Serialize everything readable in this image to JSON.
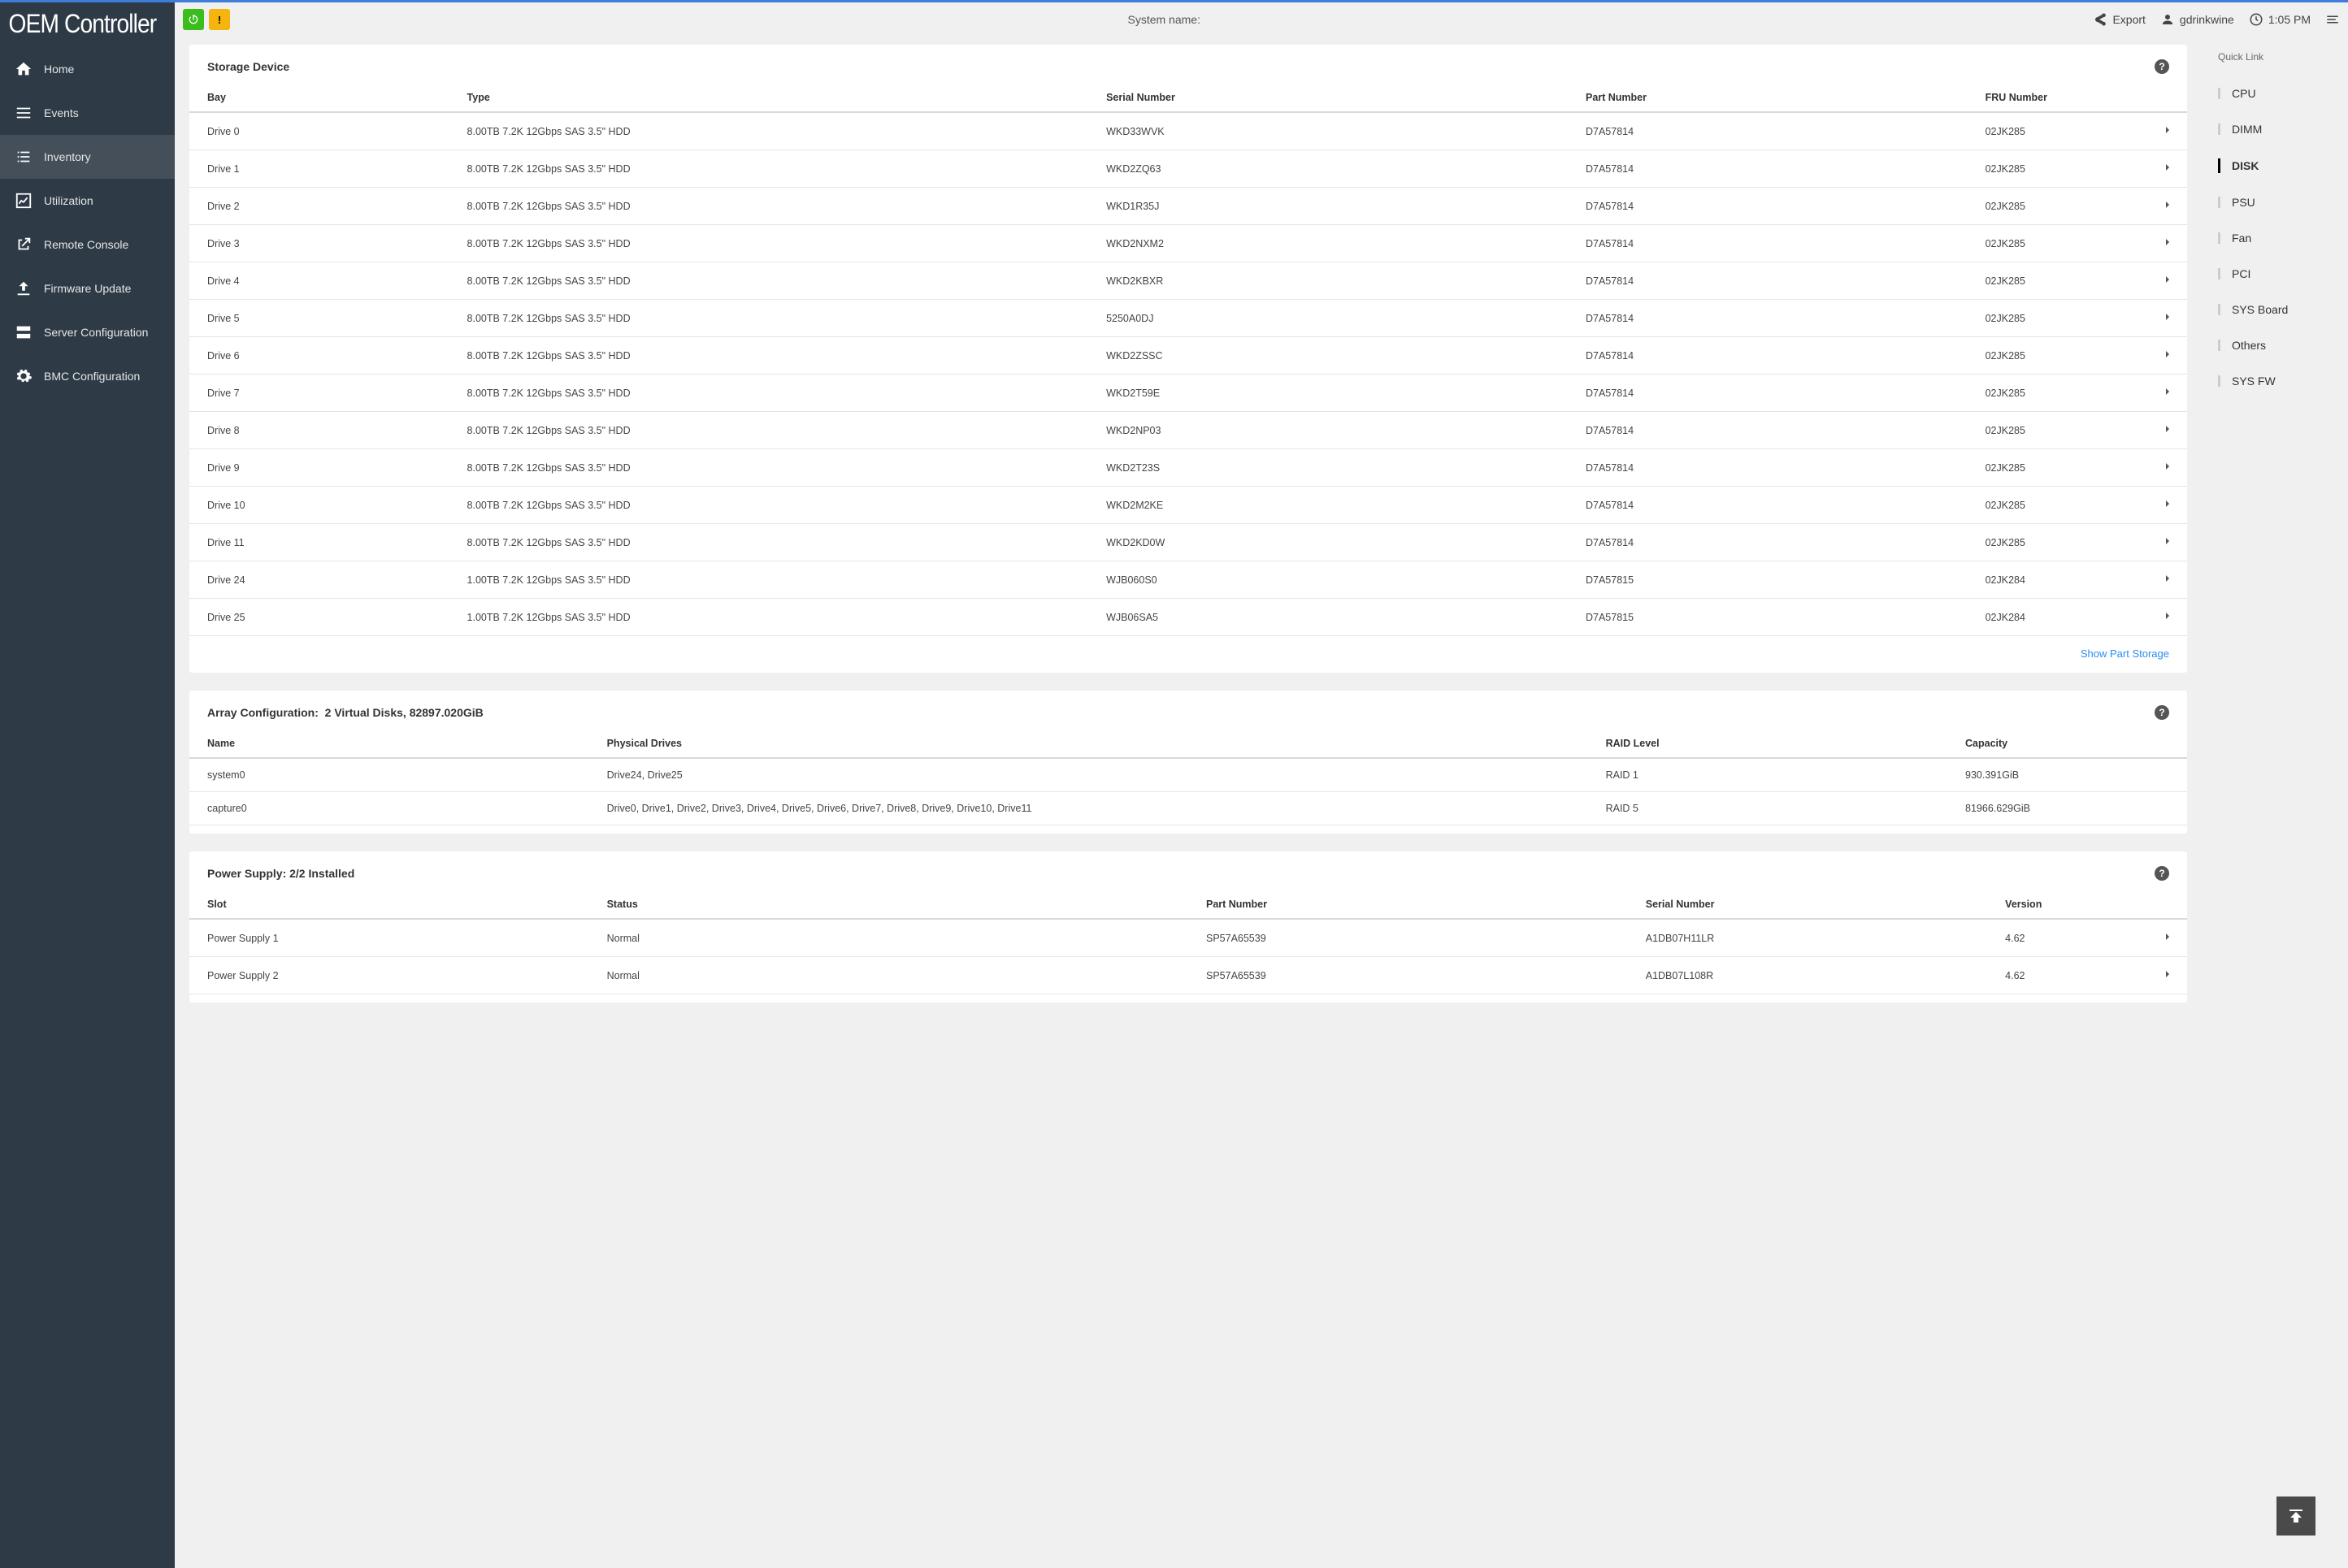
{
  "logo": "OEM Controller",
  "nav": [
    {
      "label": "Home"
    },
    {
      "label": "Events"
    },
    {
      "label": "Inventory"
    },
    {
      "label": "Utilization"
    },
    {
      "label": "Remote Console"
    },
    {
      "label": "Firmware Update"
    },
    {
      "label": "Server Configuration"
    },
    {
      "label": "BMC Configuration"
    }
  ],
  "topbar": {
    "system_name_label": "System name:",
    "export": "Export",
    "user": "gdrinkwine",
    "time": "1:05 PM"
  },
  "storage": {
    "title": "Storage Device",
    "headers": {
      "bay": "Bay",
      "type": "Type",
      "serial": "Serial Number",
      "part": "Part Number",
      "fru": "FRU Number"
    },
    "rows": [
      {
        "bay": "Drive 0",
        "type": "8.00TB 7.2K 12Gbps SAS 3.5\" HDD",
        "serial": "WKD33WVK",
        "part": "D7A57814",
        "fru": "02JK285"
      },
      {
        "bay": "Drive 1",
        "type": "8.00TB 7.2K 12Gbps SAS 3.5\" HDD",
        "serial": "WKD2ZQ63",
        "part": "D7A57814",
        "fru": "02JK285"
      },
      {
        "bay": "Drive 2",
        "type": "8.00TB 7.2K 12Gbps SAS 3.5\" HDD",
        "serial": "WKD1R35J",
        "part": "D7A57814",
        "fru": "02JK285"
      },
      {
        "bay": "Drive 3",
        "type": "8.00TB 7.2K 12Gbps SAS 3.5\" HDD",
        "serial": "WKD2NXM2",
        "part": "D7A57814",
        "fru": "02JK285"
      },
      {
        "bay": "Drive 4",
        "type": "8.00TB 7.2K 12Gbps SAS 3.5\" HDD",
        "serial": "WKD2KBXR",
        "part": "D7A57814",
        "fru": "02JK285"
      },
      {
        "bay": "Drive 5",
        "type": "8.00TB 7.2K 12Gbps SAS 3.5\" HDD",
        "serial": "5250A0DJ",
        "part": "D7A57814",
        "fru": "02JK285"
      },
      {
        "bay": "Drive 6",
        "type": "8.00TB 7.2K 12Gbps SAS 3.5\" HDD",
        "serial": "WKD2ZSSC",
        "part": "D7A57814",
        "fru": "02JK285"
      },
      {
        "bay": "Drive 7",
        "type": "8.00TB 7.2K 12Gbps SAS 3.5\" HDD",
        "serial": "WKD2T59E",
        "part": "D7A57814",
        "fru": "02JK285"
      },
      {
        "bay": "Drive 8",
        "type": "8.00TB 7.2K 12Gbps SAS 3.5\" HDD",
        "serial": "WKD2NP03",
        "part": "D7A57814",
        "fru": "02JK285"
      },
      {
        "bay": "Drive 9",
        "type": "8.00TB 7.2K 12Gbps SAS 3.5\" HDD",
        "serial": "WKD2T23S",
        "part": "D7A57814",
        "fru": "02JK285"
      },
      {
        "bay": "Drive 10",
        "type": "8.00TB 7.2K 12Gbps SAS 3.5\" HDD",
        "serial": "WKD2M2KE",
        "part": "D7A57814",
        "fru": "02JK285"
      },
      {
        "bay": "Drive 11",
        "type": "8.00TB 7.2K 12Gbps SAS 3.5\" HDD",
        "serial": "WKD2KD0W",
        "part": "D7A57814",
        "fru": "02JK285"
      },
      {
        "bay": "Drive 24",
        "type": "1.00TB 7.2K 12Gbps SAS 3.5\" HDD",
        "serial": "WJB060S0",
        "part": "D7A57815",
        "fru": "02JK284"
      },
      {
        "bay": "Drive 25",
        "type": "1.00TB 7.2K 12Gbps SAS 3.5\" HDD",
        "serial": "WJB06SA5",
        "part": "D7A57815",
        "fru": "02JK284"
      }
    ],
    "show_link": "Show Part Storage"
  },
  "array": {
    "title_prefix": "Array Configuration:",
    "title_suffix": "2 Virtual Disks, 82897.020GiB",
    "headers": {
      "name": "Name",
      "drives": "Physical Drives",
      "raid": "RAID Level",
      "cap": "Capacity"
    },
    "rows": [
      {
        "name": "system0",
        "drives": "Drive24, Drive25",
        "raid": "RAID 1",
        "cap": "930.391GiB"
      },
      {
        "name": "capture0",
        "drives": "Drive0, Drive1, Drive2, Drive3, Drive4, Drive5, Drive6, Drive7, Drive8, Drive9, Drive10, Drive11",
        "raid": "RAID 5",
        "cap": "81966.629GiB"
      }
    ]
  },
  "psu": {
    "title": "Power Supply: 2/2 Installed",
    "headers": {
      "slot": "Slot",
      "status": "Status",
      "part": "Part Number",
      "serial": "Serial Number",
      "ver": "Version"
    },
    "rows": [
      {
        "slot": "Power Supply 1",
        "status": "Normal",
        "part": "SP57A65539",
        "serial": "A1DB07H11LR",
        "ver": "4.62"
      },
      {
        "slot": "Power Supply 2",
        "status": "Normal",
        "part": "SP57A65539",
        "serial": "A1DB07L108R",
        "ver": "4.62"
      }
    ]
  },
  "quicklinks": {
    "title": "Quick Link",
    "items": [
      "CPU",
      "DIMM",
      "DISK",
      "PSU",
      "Fan",
      "PCI",
      "SYS Board",
      "Others",
      "SYS FW"
    ]
  }
}
